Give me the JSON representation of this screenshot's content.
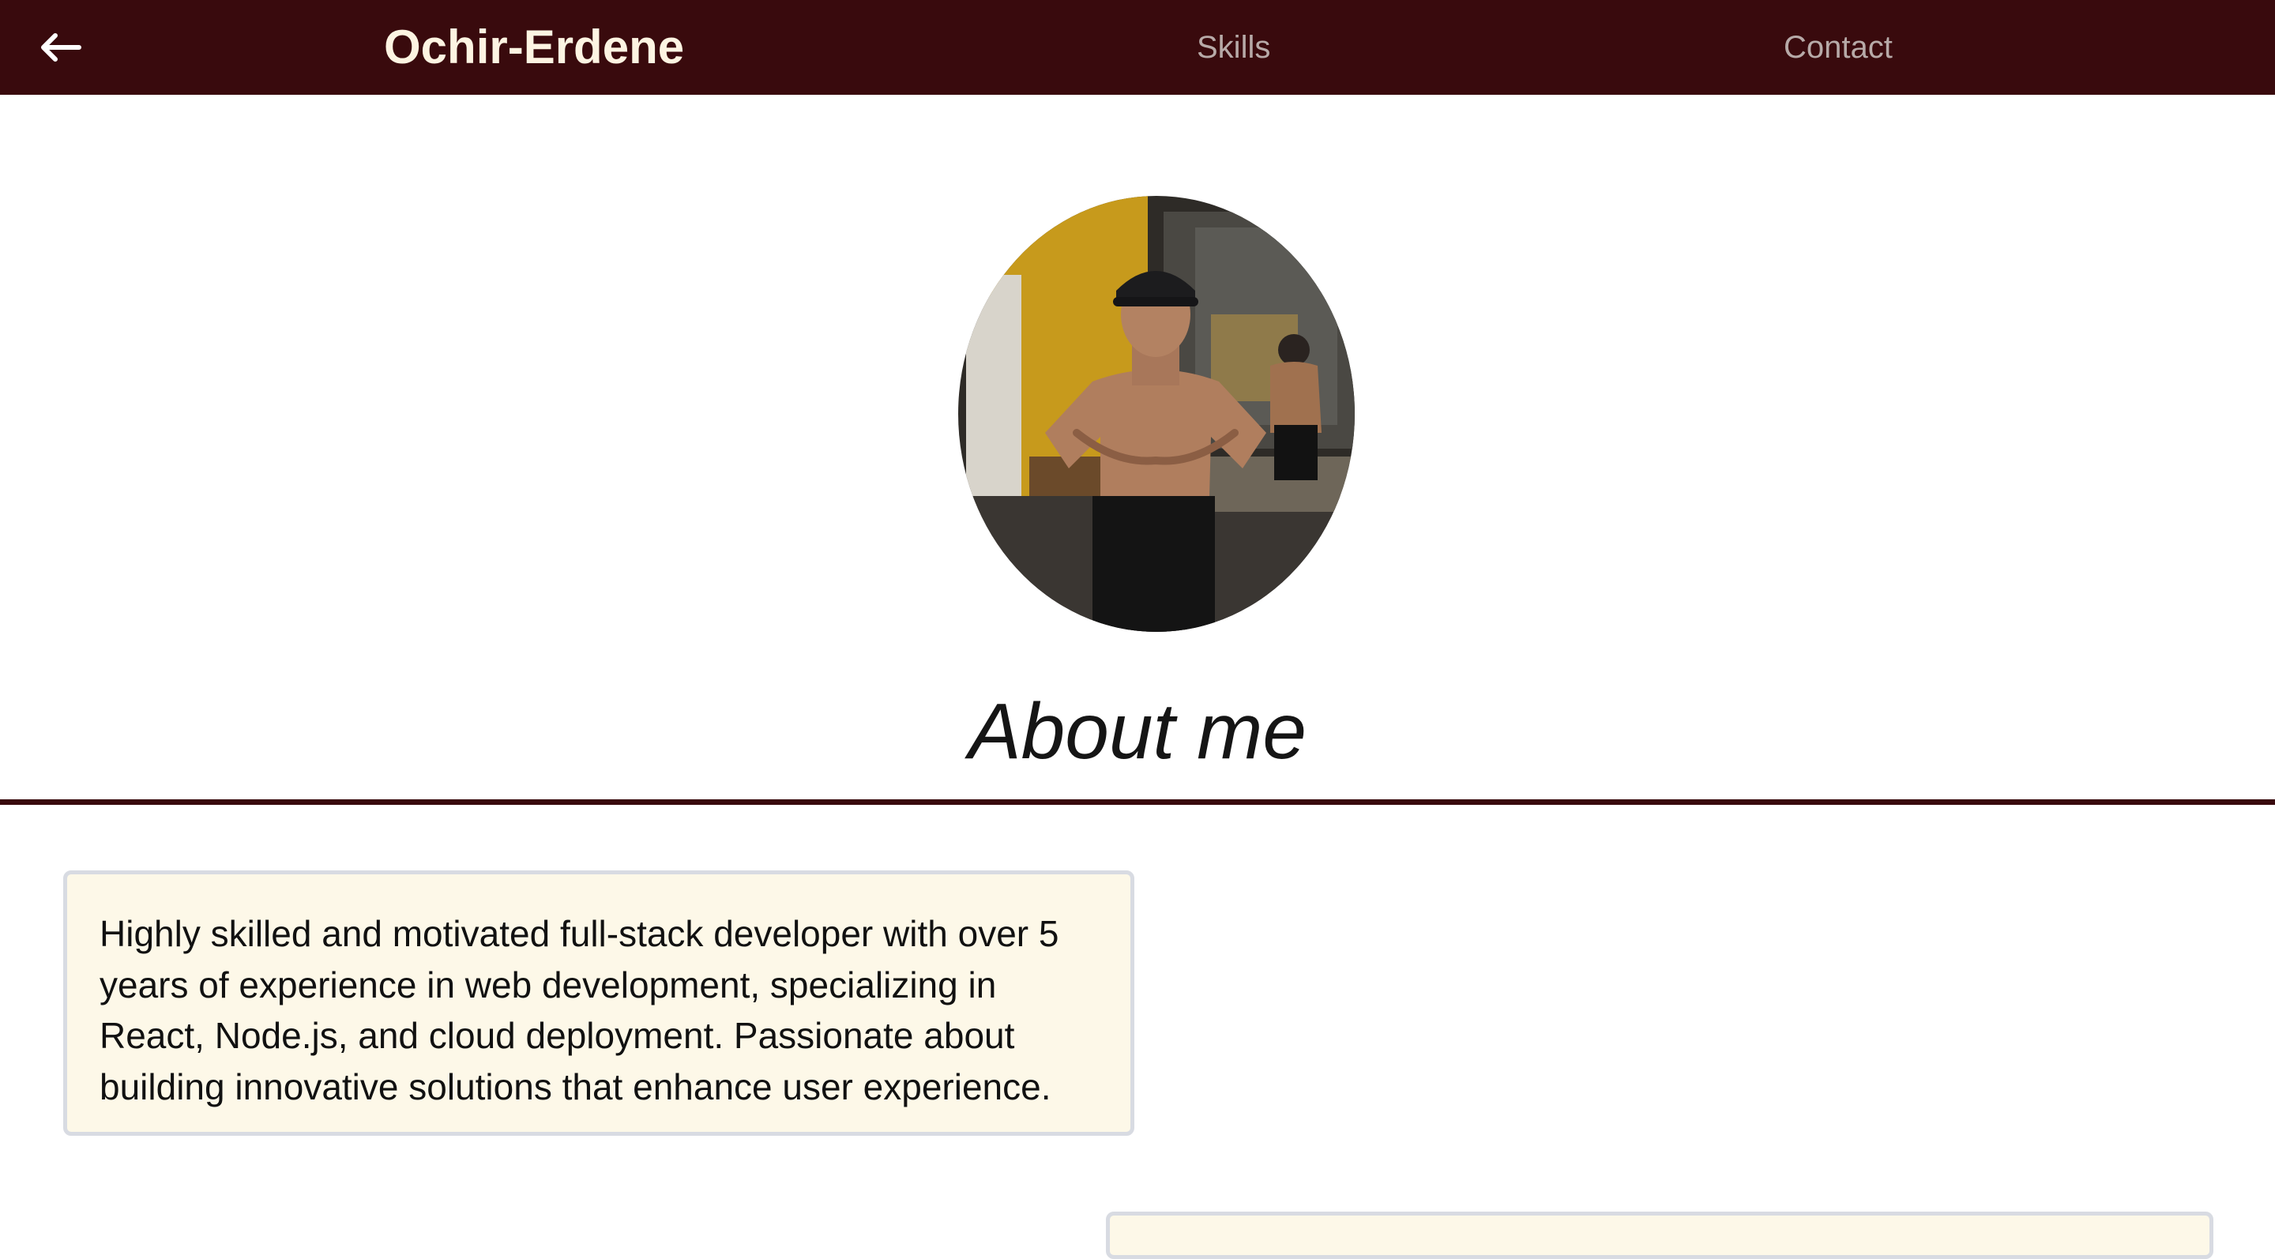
{
  "header": {
    "back_icon": "arrow-left-icon",
    "title": "Ochir-Erdene",
    "nav": [
      {
        "label": "Skills"
      },
      {
        "label": "Contact"
      }
    ]
  },
  "hero": {
    "photo_icon": "profile-photo",
    "heading": "About me"
  },
  "about": {
    "text": "Highly skilled and motivated full-stack developer with over 5 years of experience in web development, specializing in React, Node.js, and cloud deployment. Passionate about building innovative solutions that enhance user experience."
  },
  "colors": {
    "header_background": "#390a0d",
    "brand_text": "#fdf4e2",
    "nav_link": "#b7aaa8",
    "card_background": "#fdf8e8",
    "card_border": "#d8dbe2"
  }
}
